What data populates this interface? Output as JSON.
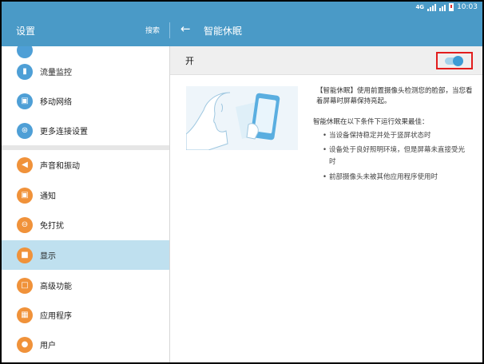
{
  "status_bar": {
    "signal": "4G",
    "time": "10:03"
  },
  "app_bar": {
    "title": "设置",
    "search_label": "搜索",
    "detail_title": "智能休眠"
  },
  "sidebar": {
    "items": [
      {
        "label": "流量监控",
        "icon": "bar-chart-icon"
      },
      {
        "label": "移动网络",
        "icon": "mobile-network-icon"
      },
      {
        "label": "更多连接设置",
        "icon": "antenna-icon"
      },
      {
        "label": "声音和振动",
        "icon": "speaker-icon"
      },
      {
        "label": "通知",
        "icon": "notification-icon"
      },
      {
        "label": "免打扰",
        "icon": "do-not-disturb-icon"
      },
      {
        "label": "显示",
        "icon": "display-icon"
      },
      {
        "label": "高级功能",
        "icon": "advanced-icon"
      },
      {
        "label": "应用程序",
        "icon": "apps-icon"
      },
      {
        "label": "用户",
        "icon": "users-icon"
      }
    ],
    "active_item": "显示"
  },
  "detail": {
    "toggle_label": "开",
    "toggle_on": true,
    "description": "【智能休眠】使用前置摄像头检测您的脸部，当您看着屏幕时屏幕保持亮起。",
    "conditions_title": "智能休眠在以下条件下运行效果最佳：",
    "conditions": [
      "当设备保持稳定并处于竖屏状态时",
      "设备处于良好照明环境，但是屏幕未直接受光时",
      "前部摄像头未被其他应用程序使用时"
    ]
  },
  "colors": {
    "appbar": "#4a9ac7",
    "active_item": "#bfe0ef",
    "toggle": "#3d9bd4",
    "highlight_box": "#e21d1d"
  }
}
